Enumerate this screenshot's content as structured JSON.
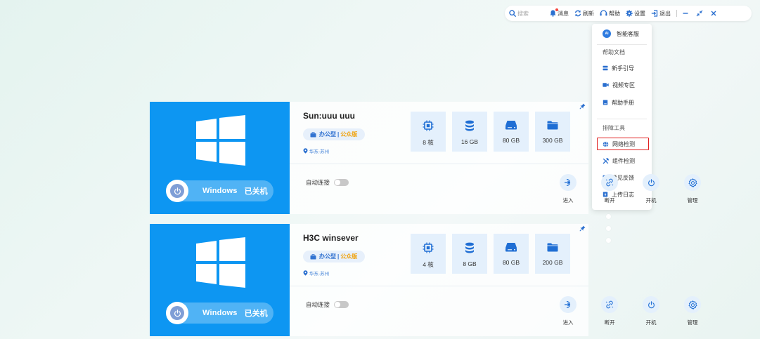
{
  "toolbar": {
    "search_placeholder": "搜索",
    "messages": "消息",
    "refresh": "刷新",
    "help": "帮助",
    "settings": "设置",
    "logout": "退出"
  },
  "help_menu": {
    "smart_service": "智能客服",
    "help_docs_heading": "帮助文档",
    "beginner_guide": "新手引导",
    "video_zone": "视频专区",
    "help_manual": "帮助手册",
    "troubleshoot_heading": "排障工具",
    "network_check": "网络检测",
    "component_check": "组件检测",
    "feedback": "意见反馈",
    "upload_log": "上传日志",
    "ai_badge": "AI"
  },
  "desktops": [
    {
      "name": "Sun:uuu uuu",
      "type": "办公型",
      "edition": "公众版",
      "region": "华东-苏州",
      "os": "Windows",
      "state": "已关机",
      "cpu": "8 核",
      "memory": "16 GB",
      "system_disk": "80 GB",
      "data_disk": "300 GB",
      "auto_connect_label": "自动连接",
      "auto_connect": false,
      "actions": {
        "enter": "进入",
        "disconnect": "断开",
        "power_on": "开机",
        "manage": "管理"
      }
    },
    {
      "name": "H3C winsever",
      "type": "办公型",
      "edition": "公众版",
      "region": "华东-苏州",
      "os": "Windows",
      "state": "已关机",
      "cpu": "4 核",
      "memory": "8 GB",
      "system_disk": "80 GB",
      "data_disk": "200 GB",
      "auto_connect_label": "自动连接",
      "auto_connect": false,
      "actions": {
        "enter": "进入",
        "disconnect": "断开",
        "power_on": "开机",
        "manage": "管理"
      }
    }
  ],
  "colors": {
    "accent": "#0d96f2",
    "spec_bg": "#e4f0fc",
    "edition": "#f0a20c",
    "highlight_border": "#e02020"
  }
}
